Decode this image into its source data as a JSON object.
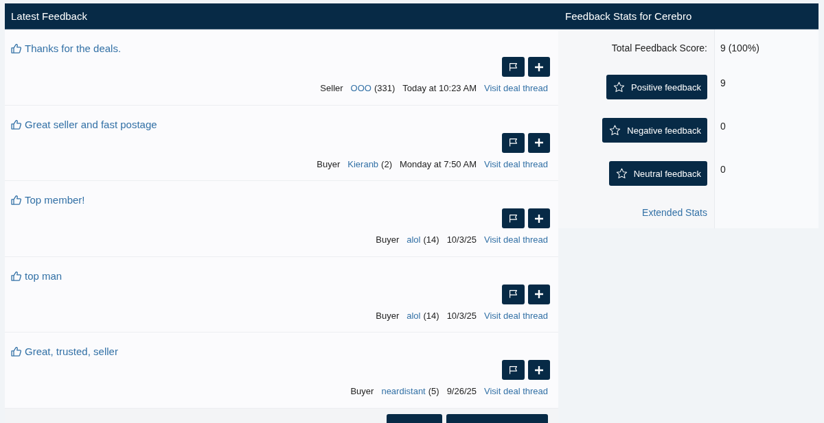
{
  "feedback": {
    "title": "Latest Feedback",
    "items": [
      {
        "comment": "Thanks for the deals.",
        "role": "Seller",
        "user": "OOO",
        "user_feedback_count": "(331)",
        "date": "Today at 10:23 AM",
        "link": "Visit deal thread"
      },
      {
        "comment": "Great seller and fast postage",
        "role": "Buyer",
        "user": "Kieranb",
        "user_feedback_count": "(2)",
        "date": "Monday at 7:50 AM",
        "link": "Visit deal thread"
      },
      {
        "comment": "Top member!",
        "role": "Buyer",
        "user": "alol",
        "user_feedback_count": "(14)",
        "date": "10/3/25",
        "link": "Visit deal thread"
      },
      {
        "comment": "top man",
        "role": "Buyer",
        "user": "alol",
        "user_feedback_count": "(14)",
        "date": "10/3/25",
        "link": "Visit deal thread"
      },
      {
        "comment": "Great, trusted, seller",
        "role": "Buyer",
        "user": "neardistant",
        "user_feedback_count": "(5)",
        "date": "9/26/25",
        "link": "Visit deal thread"
      }
    ]
  },
  "stats": {
    "title": "Feedback Stats for Cerebro",
    "total_label": "Total Feedback Score:",
    "total_value": "9 (100%)",
    "rows": [
      {
        "label": "Positive feedback",
        "value": "9"
      },
      {
        "label": "Negative feedback",
        "value": "0"
      },
      {
        "label": "Neutral feedback",
        "value": "0"
      }
    ],
    "extended_link": "Extended Stats"
  }
}
